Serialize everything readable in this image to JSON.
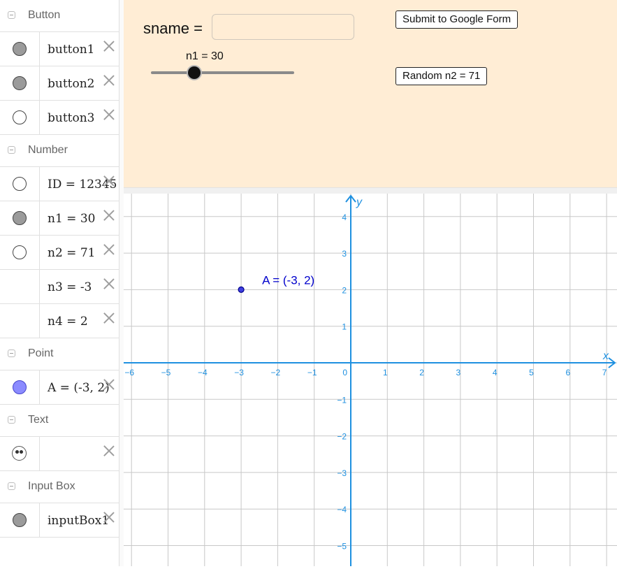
{
  "algebra": {
    "sections": [
      {
        "title": "Button",
        "items": [
          {
            "label": "button1",
            "marble": "on"
          },
          {
            "label": "button2",
            "marble": "on"
          },
          {
            "label": "button3",
            "marble": "off"
          }
        ]
      },
      {
        "title": "Number",
        "items": [
          {
            "label": "ID = 12345",
            "marble": "off"
          },
          {
            "label": "n1 = 30",
            "marble": "on"
          },
          {
            "label": "n2 = 71",
            "marble": "off"
          },
          {
            "label": "n3 = -3",
            "marble": "none"
          },
          {
            "label": "n4 = 2",
            "marble": "none"
          }
        ]
      },
      {
        "title": "Point",
        "items": [
          {
            "label": "A = (-3, 2)",
            "marble": "point"
          }
        ]
      },
      {
        "title": "Text",
        "items": [
          {
            "label": "",
            "marble": "quote"
          }
        ]
      },
      {
        "title": "Input Box",
        "items": [
          {
            "label": "inputBox1",
            "marble": "on"
          }
        ]
      }
    ]
  },
  "panel": {
    "sname_label": "sname =",
    "sname_value": "",
    "slider_label": "n1 = 30",
    "slider": {
      "min": 0,
      "max": 100,
      "value": 30
    },
    "submit_label": "Submit to Google Form",
    "random_label": "Random n2 = 71"
  },
  "graph": {
    "x_axis_label": "x",
    "y_axis_label": "y",
    "x_ticks": [
      "−6",
      "−5",
      "−4",
      "−3",
      "−2",
      "−1",
      "0",
      "1",
      "2",
      "3",
      "4",
      "5",
      "6",
      "7"
    ],
    "y_ticks": [
      "4",
      "3",
      "2",
      "1",
      "−1",
      "−2",
      "−3",
      "−4",
      "−5"
    ],
    "point": {
      "name": "A",
      "x": -3,
      "y": 2,
      "label": "A = (-3, 2)",
      "color": "#0000cc"
    },
    "axis_color": "#1e90e0",
    "grid_color": "#c8c8c8"
  }
}
